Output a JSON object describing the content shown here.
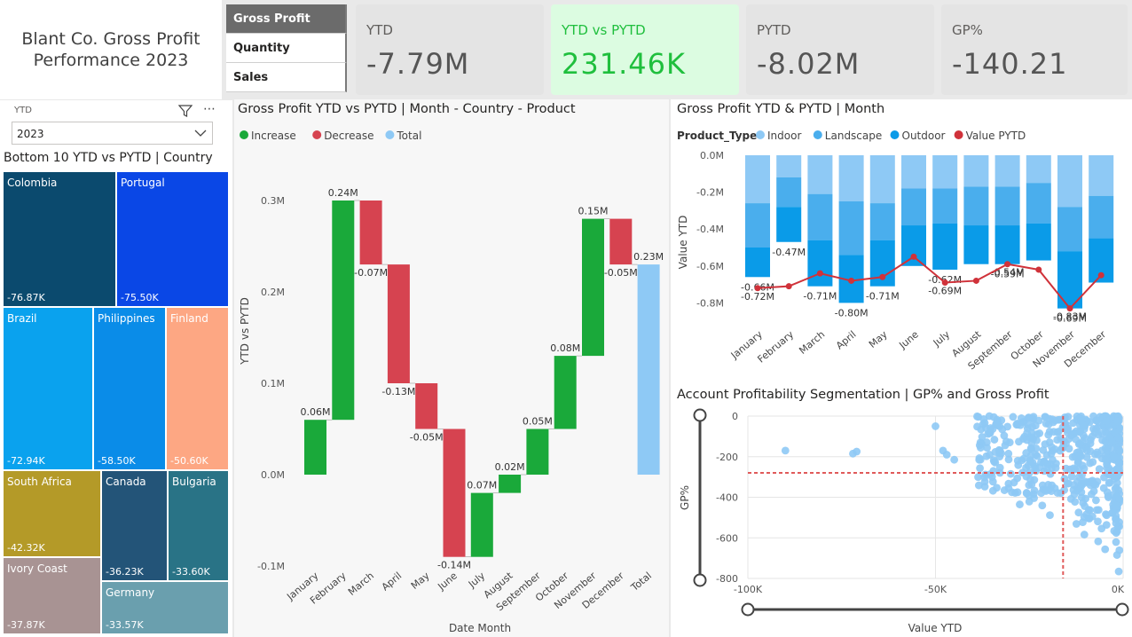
{
  "report_title": "Blant Co. Gross Profit Performance 2023",
  "tabs": [
    {
      "label": "Gross Profit",
      "active": true
    },
    {
      "label": "Quantity",
      "active": false
    },
    {
      "label": "Sales",
      "active": false
    }
  ],
  "kpis": [
    {
      "label": "YTD",
      "value": "-7.79M"
    },
    {
      "label": "YTD vs PYTD",
      "value": "231.46K"
    },
    {
      "label": "PYTD",
      "value": "-8.02M"
    },
    {
      "label": "GP%",
      "value": "-140.21"
    }
  ],
  "slicer": {
    "label": "YTD",
    "value": "2023"
  },
  "treemap": {
    "title": "Bottom 10 YTD vs PYTD | Country",
    "items": [
      {
        "name": "Colombia",
        "value": "-76.87K",
        "color": "#0b4a6e"
      },
      {
        "name": "Portugal",
        "value": "-75.50K",
        "color": "#0a47e6"
      },
      {
        "name": "Brazil",
        "value": "-72.94K",
        "color": "#0aa2ee"
      },
      {
        "name": "Philippines",
        "value": "-58.50K",
        "color": "#0a8ce8"
      },
      {
        "name": "Finland",
        "value": "-50.60K",
        "color": "#fda783"
      },
      {
        "name": "South Africa",
        "value": "-42.32K",
        "color": "#b49a28"
      },
      {
        "name": "Canada",
        "value": "-36.23K",
        "color": "#235478"
      },
      {
        "name": "Bulgaria",
        "value": "-33.60K",
        "color": "#297386"
      },
      {
        "name": "Ivory Coast",
        "value": "-37.87K",
        "color": "#a89393"
      },
      {
        "name": "Germany",
        "value": "-33.57K",
        "color": "#6a9fae"
      }
    ]
  },
  "chart_data": [
    {
      "type": "bar",
      "subtype": "waterfall",
      "title": "Gross Profit YTD vs PYTD | Month - Country - Product",
      "legend": [
        "Increase",
        "Decrease",
        "Total"
      ],
      "legend_colors": {
        "Increase": "#1aa93a",
        "Decrease": "#d64350",
        "Total": "#8ec9f5"
      },
      "xlabel": "Date Month",
      "ylabel": "YTD vs PYTD",
      "yticks": [
        "0.3M",
        "0.2M",
        "0.1M",
        "0.0M",
        "-0.1M"
      ],
      "categories": [
        "January",
        "February",
        "March",
        "April",
        "May",
        "June",
        "July",
        "August",
        "September",
        "October",
        "November",
        "December",
        "Total"
      ],
      "values": [
        0.06,
        0.24,
        -0.07,
        -0.13,
        -0.05,
        -0.14,
        0.07,
        0.02,
        0.05,
        0.08,
        0.15,
        -0.05,
        0.23
      ],
      "data_labels": [
        "0.06M",
        "0.24M",
        "-0.07M",
        "-0.13M",
        "-0.05M",
        "-0.14M",
        "0.07M",
        "0.02M",
        "0.05M",
        "0.08M",
        "0.15M",
        "-0.05M",
        "0.23M"
      ],
      "ylim": [
        -0.1,
        0.3
      ]
    },
    {
      "type": "bar",
      "subtype": "stacked-bar-with-line",
      "title": "Gross Profit YTD & PYTD | Month",
      "legend_title": "Product_Type",
      "legend": [
        "Indoor",
        "Landscape",
        "Outdoor",
        "Value PYTD"
      ],
      "colors": {
        "Indoor": "#8ec9f5",
        "Landscape": "#4aaeed",
        "Outdoor": "#0a9be8",
        "Value PYTD": "#d0323a"
      },
      "ylabel": "Value YTD",
      "yticks": [
        "0.0M",
        "-0.2M",
        "-0.4M",
        "-0.6M",
        "-0.8M"
      ],
      "categories": [
        "January",
        "February",
        "March",
        "April",
        "May",
        "June",
        "July",
        "August",
        "September",
        "October",
        "November",
        "December"
      ],
      "series": [
        {
          "name": "Indoor",
          "values": [
            -0.26,
            -0.12,
            -0.21,
            -0.25,
            -0.26,
            -0.18,
            -0.18,
            -0.17,
            -0.17,
            -0.15,
            -0.28,
            -0.22
          ]
        },
        {
          "name": "Landscape",
          "values": [
            -0.24,
            -0.16,
            -0.25,
            -0.29,
            -0.2,
            -0.2,
            -0.19,
            -0.21,
            -0.21,
            -0.22,
            -0.24,
            -0.23
          ]
        },
        {
          "name": "Outdoor",
          "values": [
            -0.16,
            -0.19,
            -0.25,
            -0.26,
            -0.25,
            -0.22,
            -0.25,
            -0.21,
            -0.21,
            -0.2,
            -0.31,
            -0.24
          ]
        },
        {
          "name": "Value PYTD",
          "values": [
            -0.72,
            -0.71,
            -0.64,
            -0.68,
            -0.66,
            -0.55,
            -0.69,
            -0.68,
            -0.59,
            -0.62,
            -0.83,
            -0.65
          ]
        }
      ],
      "bar_labels": [
        "-0.66M",
        "-0.47M",
        "-0.71M",
        "-0.80M",
        "-0.71M",
        "",
        "-0.62M",
        "",
        "-0.59M",
        "",
        "-0.69M",
        ""
      ],
      "line_labels": [
        "-0.72M",
        "",
        "",
        "",
        "",
        "",
        "-0.69M",
        "",
        "-0.54M",
        "",
        "-0.83M",
        ""
      ],
      "ylim": [
        -0.8,
        0.0
      ]
    },
    {
      "type": "scatter",
      "title": "Account Profitability Segmentation | GP% and Gross Profit",
      "xlabel": "Value YTD",
      "ylabel": "GP%",
      "xticks": [
        "-100K",
        "-50K",
        "0K"
      ],
      "yticks": [
        "0",
        "-200",
        "-400",
        "-600",
        "-800"
      ],
      "xlim": [
        -100,
        0
      ],
      "ylim": [
        -800,
        0
      ],
      "ref_x": -16,
      "ref_y": -280,
      "point_color": "#8ec9f5"
    }
  ]
}
